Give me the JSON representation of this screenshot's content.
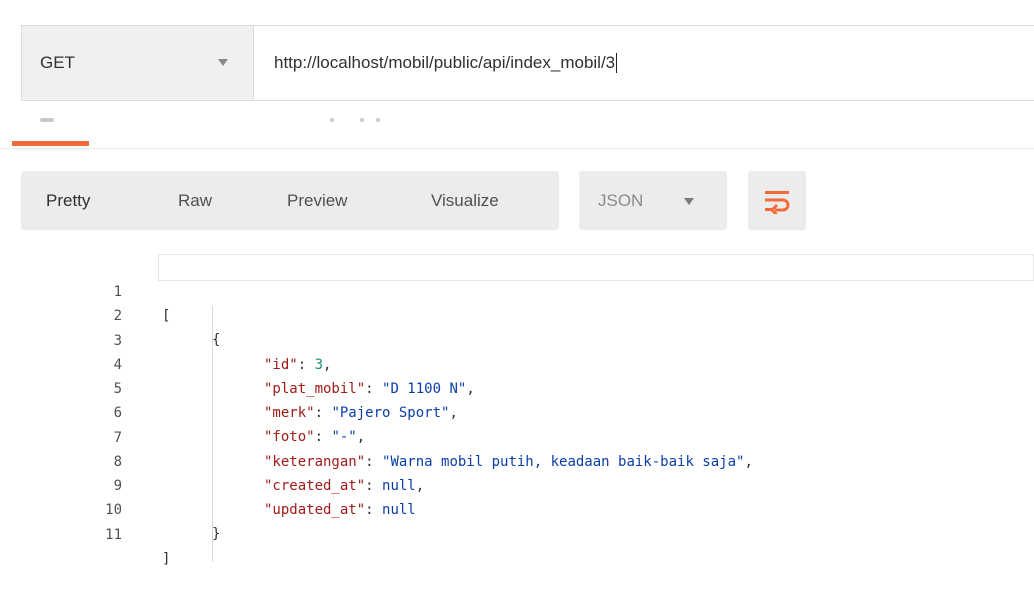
{
  "request": {
    "method": "GET",
    "url": "http://localhost/mobil/public/api/index_mobil/3"
  },
  "response_toolbar": {
    "views": [
      "Pretty",
      "Raw",
      "Preview",
      "Visualize"
    ],
    "active_view": "Pretty",
    "format": "JSON",
    "wrap_icon": "wrap-lines-icon",
    "accent_color": "#f26b3a"
  },
  "editor": {
    "line_numbers": [
      "1",
      "2",
      "3",
      "4",
      "5",
      "6",
      "7",
      "8",
      "9",
      "10",
      "11"
    ],
    "lines": {
      "l1": "[",
      "l2": "{",
      "l3_key": "\"id\"",
      "l3_val": "3",
      "l4_key": "\"plat_mobil\"",
      "l4_val": "\"D 1100 N\"",
      "l5_key": "\"merk\"",
      "l5_val": "\"Pajero Sport\"",
      "l6_key": "\"foto\"",
      "l6_val": "\"-\"",
      "l7_key": "\"keterangan\"",
      "l7_val": "\"Warna mobil putih, keadaan baik-baik saja\"",
      "l8_key": "\"created_at\"",
      "l8_val": "null",
      "l9_key": "\"updated_at\"",
      "l9_val": "null",
      "l10": "}",
      "l11": "]"
    }
  }
}
